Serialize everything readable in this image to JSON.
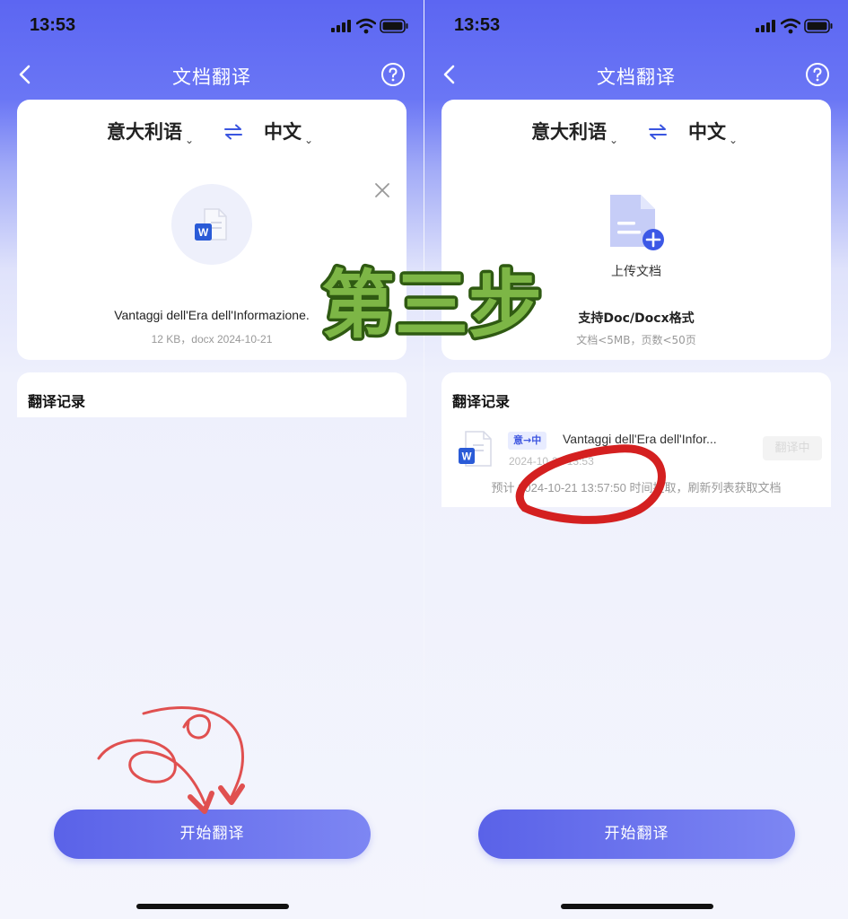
{
  "status_bar": {
    "time": "13:53"
  },
  "nav": {
    "title": "文档翻译"
  },
  "languages": {
    "source": "意大利语",
    "target": "中文"
  },
  "left_screen": {
    "file_name": "Vantaggi dell'Era dell'Informazione.",
    "file_meta": "12 KB，docx 2024-10-21",
    "record_title": "翻译记录",
    "start_button": "开始翻译"
  },
  "right_screen": {
    "upload_label": "上传文档",
    "support_title": "支持Doc/Docx格式",
    "support_sub": "文档<5MB，页数<50页",
    "record_title": "翻译记录",
    "record": {
      "badge": "意→中",
      "name": "Vantaggi dell'Era dell'Infor...",
      "time": "2024-10-21 13:53",
      "status": "翻译中",
      "note": "预计 2024-10-21 13:57:50 时间提取，刷新列表获取文档"
    },
    "start_button": "开始翻译"
  },
  "overlay": {
    "step_text": "第三步"
  },
  "colors": {
    "accent": "#5a62e8",
    "badge_bg": "#e8ecff",
    "badge_text": "#3e56e0",
    "annotation_red": "#d42020",
    "step_fill": "#7db646",
    "step_outline": "#2f5a12"
  },
  "icons": [
    "signal-icon",
    "wifi-icon",
    "battery-icon",
    "back-chevron-icon",
    "help-icon",
    "swap-icon",
    "word-file-icon",
    "close-icon",
    "upload-file-icon"
  ]
}
